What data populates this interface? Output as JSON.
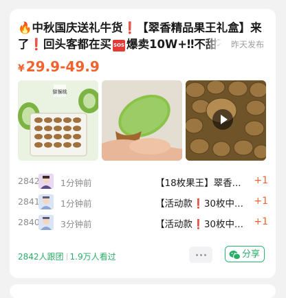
{
  "post": {
    "title_line1": "中秋国庆送礼牛货",
    "title_line1b": "【翠香精品果王礼盒】来",
    "title_line2a": "了",
    "title_line2b": "回头客都在买",
    "title_line2c": "爆卖10W+‼不甜不",
    "sos_label": "SOS",
    "posted_time": "昨天发布",
    "price_currency": "¥",
    "price_range": "29.9-49.9",
    "box_label": "猕猴桃"
  },
  "buyers": [
    {
      "number": "2842",
      "ago": "1分钟前",
      "product": "【18枚果王】翠香...",
      "qty": "+1"
    },
    {
      "number": "2841",
      "ago": "1分钟前",
      "product_prefix": "【活动款",
      "product_suffix": "30枚中...",
      "qty": "+1"
    },
    {
      "number": "2840",
      "ago": "3分钟前",
      "product_prefix": "【活动款",
      "product_suffix": "30枚中...",
      "qty": "+1"
    }
  ],
  "footer": {
    "joined": "2842人跟团",
    "viewed": "1.9万人看过",
    "share_label": "分享"
  },
  "colors": {
    "accent_orange": "#f0632f",
    "wechat_green": "#2aae67",
    "alert_red": "#d32f2f"
  }
}
